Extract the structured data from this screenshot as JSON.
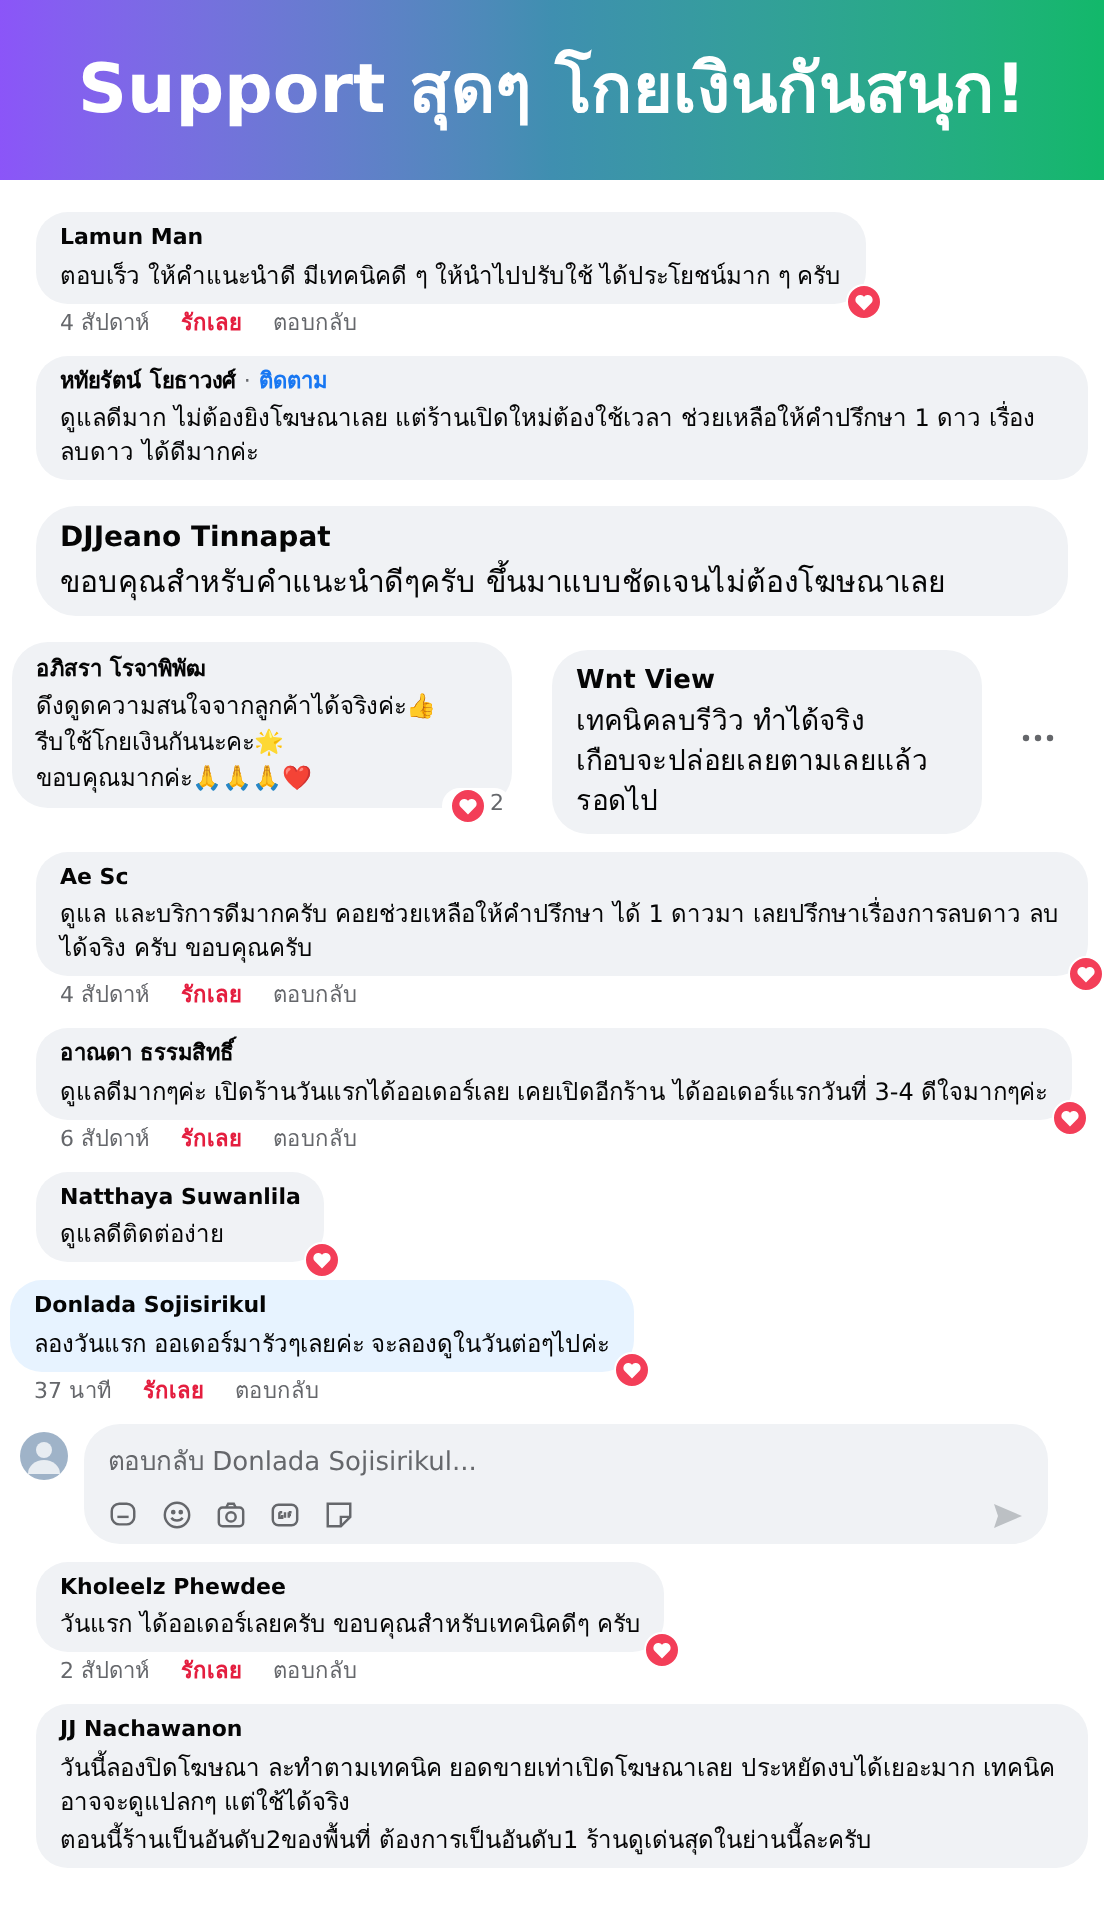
{
  "header": {
    "title": "Support สุดๆ โกยเงินกันสนุก!"
  },
  "items": [
    {
      "kind": "comment",
      "name": "Lamun Man",
      "text": [
        "ตอบเร็ว ให้คำแนะนำดี มีเทคนิคดี ๆ ให้นำไปปรับใช้ ได้ประโยชน์มาก ๆ ครับ"
      ],
      "time": "4 สัปดาห์",
      "like": "รักเลย",
      "reply": "ตอบกลับ",
      "reacted": true,
      "highlighted": false
    },
    {
      "kind": "comment",
      "name": "หทัยรัตน์ โยธาวงศ์",
      "separator": "·",
      "follow": "ติดตาม",
      "text": [
        "ดูแลดีมาก ไม่ต้องยิงโฆษณาเลย แต่ร้านเปิดใหม่ต้องใช้เวลา ช่วยเหลือให้คำปรึกษา 1 ดาว เรื่องลบดาว ได้ดีมากค่ะ"
      ],
      "reacted": false,
      "highlighted": false
    },
    {
      "kind": "big",
      "name": "DJJeano Tinnapat",
      "text": [
        "ขอบคุณสำหรับคำแนะนำดีๆครับ ขึ้นมาแบบชัดเจนไม่ต้องโฆษณาเลย"
      ]
    },
    {
      "kind": "pair",
      "left": {
        "name": "อภิสรา โรจาพิพัฒ",
        "lines": [
          "ดึงดูดความสนใจจากลูกค้าได้จริงค่ะ👍",
          "รีบใช้โกยเงินกันนะคะ🌟",
          "ขอบคุณมากค่ะ🙏🙏🙏❤️"
        ],
        "count": "2"
      },
      "right": {
        "name": "Wnt View",
        "lines": [
          "เทคนิคลบรีวิว ทำได้จริง",
          "เกือบจะปล่อยเลยตามเลยแล้ว",
          "รอดไป"
        ]
      }
    },
    {
      "kind": "comment",
      "name": "Ae Sc",
      "text": [
        "ดูแล และบริการดีมากครับ คอยช่วยเหลือให้คำปรึกษา ได้ 1 ดาวมา เลยปรึกษาเรื่องการลบดาว ลบได้จริง ครับ ขอบคุณครับ"
      ],
      "time": "4 สัปดาห์",
      "like": "รักเลย",
      "reply": "ตอบกลับ",
      "reacted": true,
      "highlighted": false
    },
    {
      "kind": "comment",
      "name": "อาณดา ธรรมสิทธิ์",
      "text": [
        "ดูแลดีมากๆค่ะ เปิดร้านวันแรกได้ออเดอร์เลย เคยเปิดอีกร้าน ได้ออเดอร์แรกวันที่ 3-4 ดีใจมากๆค่ะ"
      ],
      "time": "6 สัปดาห์",
      "like": "รักเลย",
      "reply": "ตอบกลับ",
      "reacted": true,
      "highlighted": false
    },
    {
      "kind": "comment",
      "name": "Natthaya Suwanlila",
      "text": [
        "ดูแลดีติดต่อง่าย"
      ],
      "reacted": true,
      "highlighted": false
    },
    {
      "kind": "comment",
      "name": "Donlada Sojisirikul",
      "text": [
        "ลองวันแรก ออเดอร์มารัวๆเลยค่ะ จะลองดูในวันต่อๆไปค่ะ"
      ],
      "time": "37 นาที",
      "like": "รักเลย",
      "reply": "ตอบกลับ",
      "reacted": true,
      "highlighted": true
    },
    {
      "kind": "reply_box",
      "placeholder": "ตอบกลับ Donlada Sojisirikul..."
    },
    {
      "kind": "comment",
      "name": "Kholeelz Phewdee",
      "text": [
        "วันแรก ได้ออเดอร์เลยครับ ขอบคุณสำหรับเทคนิคดีๆ ครับ"
      ],
      "time": "2 สัปดาห์",
      "like": "รักเลย",
      "reply": "ตอบกลับ",
      "reacted": true,
      "highlighted": false
    },
    {
      "kind": "comment",
      "name": "JJ Nachawanon",
      "text": [
        "วันนี้ลองปิดโฆษณา ละทำตามเทคนิค ยอดขายเท่าเปิดโฆษณาเลย ประหยัดงบได้เยอะมาก เทคนิคอาจจะดูแปลกๆ แต่ใช้ได้จริง",
        "ตอนนี้ร้านเป็นอันดับ2ของพื้นที่ ต้องการเป็นอันดับ1 ร้านดูเด่นสุดในย่านนี้ละครับ"
      ],
      "reacted": false,
      "highlighted": false
    }
  ]
}
